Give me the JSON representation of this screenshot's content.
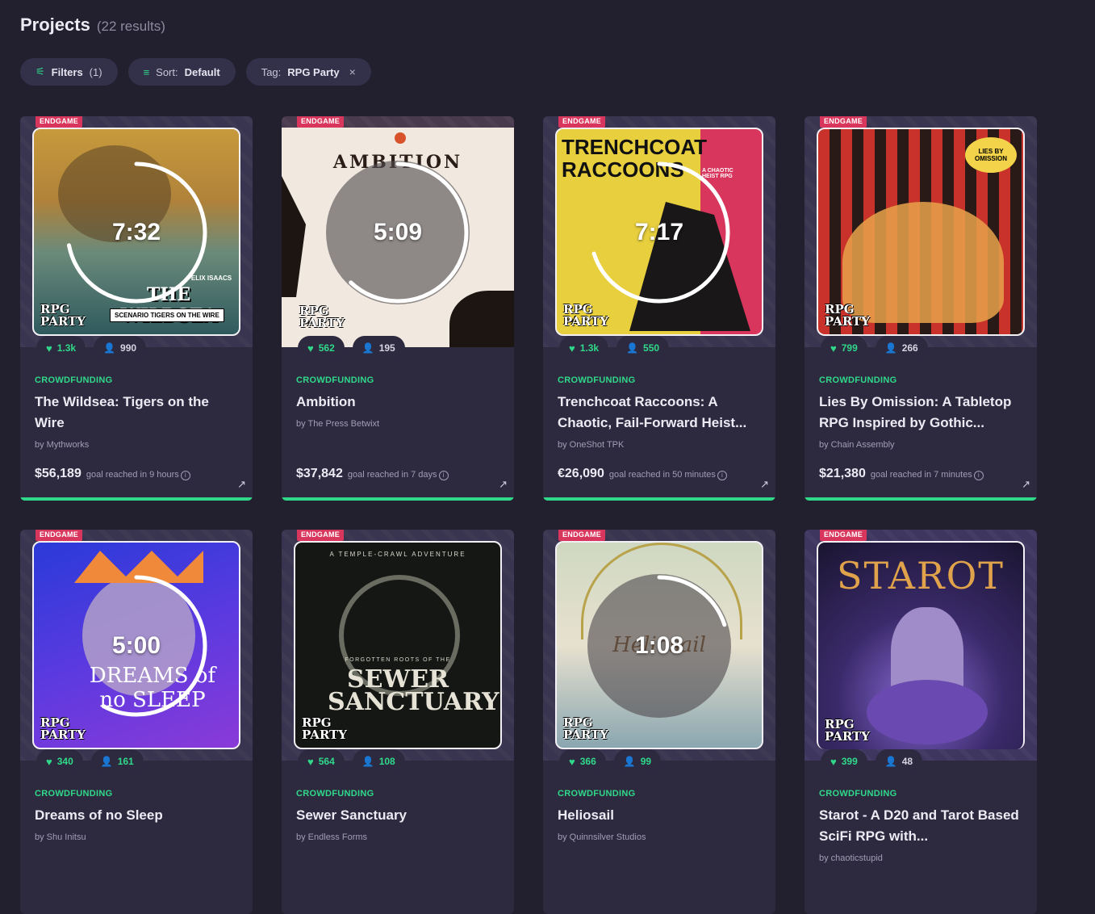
{
  "header": {
    "title": "Projects",
    "count": "(22 results)"
  },
  "toolbar": {
    "filters_label": "Filters",
    "filters_count": "(1)",
    "sort_prefix": "Sort:",
    "sort_value": "Default",
    "tag_prefix": "Tag:",
    "tag_value": "RPG Party",
    "tag_remove": "×"
  },
  "icons": {
    "filter": "sliders-icon",
    "sort": "sort-lines-icon",
    "heart": "heart-icon",
    "backers": "person-icon",
    "info": "info-icon",
    "external": "arrow-up-right-icon"
  },
  "colors": {
    "accent": "#2fd989",
    "badge": "#d8365d",
    "background": "#22202e",
    "card": "#2d2a40"
  },
  "projects": [
    {
      "badge": "ENDGAME",
      "time": "7:32",
      "progress": 0.72,
      "likes": "1.3k",
      "backers": "990",
      "category": "CROWDFUNDING",
      "name": "The Wildsea: Tigers on the Wire",
      "creator": "by Mythworks",
      "amount": "$56,189",
      "goal": "goal reached in 9 hours",
      "cover_text": "THE WILDSEA",
      "cover_sub": "SCENARIO  TIGERS ON THE WIRE",
      "cover_author": "FELIX ISAACS",
      "logo": "RPG PARTY"
    },
    {
      "badge": "ENDGAME",
      "time": "5:09",
      "progress": 0.62,
      "likes": "562",
      "backers": "195",
      "category": "CROWDFUNDING",
      "name": "Ambition",
      "creator": "by The Press Betwixt",
      "amount": "$37,842",
      "goal": "goal reached in 7 days",
      "cover_text": "AMBITION",
      "logo": "RPG PARTY"
    },
    {
      "badge": "ENDGAME",
      "time": "7:17",
      "progress": 0.7,
      "likes": "1.3k",
      "backers": "550",
      "category": "CROWDFUNDING",
      "name": "Trenchcoat Raccoons: A Chaotic, Fail-Forward Heist...",
      "creator": "by OneShot TPK",
      "amount": "€26,090",
      "goal": "goal reached in 50 minutes",
      "cover_text": "TRENCHCOAT RACCOONS",
      "cover_sub": "A CHAOTIC HEIST RPG",
      "logo": "RPG PARTY"
    },
    {
      "badge": "ENDGAME",
      "time": "",
      "progress": 0,
      "likes": "799",
      "backers": "266",
      "category": "CROWDFUNDING",
      "name": "Lies By Omission: A Tabletop RPG Inspired by Gothic...",
      "creator": "by Chain Assembly",
      "amount": "$21,380",
      "goal": "goal reached in 7 minutes",
      "cover_text": "LIES BY OMISSION",
      "logo": "RPG PARTY"
    },
    {
      "badge": "ENDGAME",
      "time": "5:00",
      "progress": 0.58,
      "likes": "340",
      "backers": "161",
      "category": "CROWDFUNDING",
      "name": "Dreams of no Sleep",
      "creator": "by Shu Initsu",
      "cover_text": "DREAMS of no SLEEP",
      "logo": "RPG PARTY"
    },
    {
      "badge": "ENDGAME",
      "time": "",
      "progress": 0,
      "likes": "564",
      "backers": "108",
      "category": "CROWDFUNDING",
      "name": "Sewer Sanctuary",
      "creator": "by Endless Forms",
      "cover_text": "SEWER SANCTUARY",
      "cover_top": "A TEMPLE-CRAWL ADVENTURE",
      "cover_sub": "FORGOTTEN ROOTS OF THE",
      "logo": "RPG PARTY"
    },
    {
      "badge": "ENDGAME",
      "time": "1:08",
      "progress": 0.2,
      "likes": "366",
      "backers": "99",
      "category": "CROWDFUNDING",
      "name": "Heliosail",
      "creator": "by Quinnsilver Studios",
      "cover_text": "Heliosail",
      "logo": "RPG PARTY"
    },
    {
      "badge": "ENDGAME",
      "time": "",
      "progress": 0,
      "likes": "399",
      "backers": "48",
      "category": "CROWDFUNDING",
      "name": "Starot - A D20 and Tarot Based SciFi RPG with...",
      "creator": "by chaoticstupid",
      "cover_text": "STAROT",
      "logo": "RPG PARTY"
    }
  ]
}
